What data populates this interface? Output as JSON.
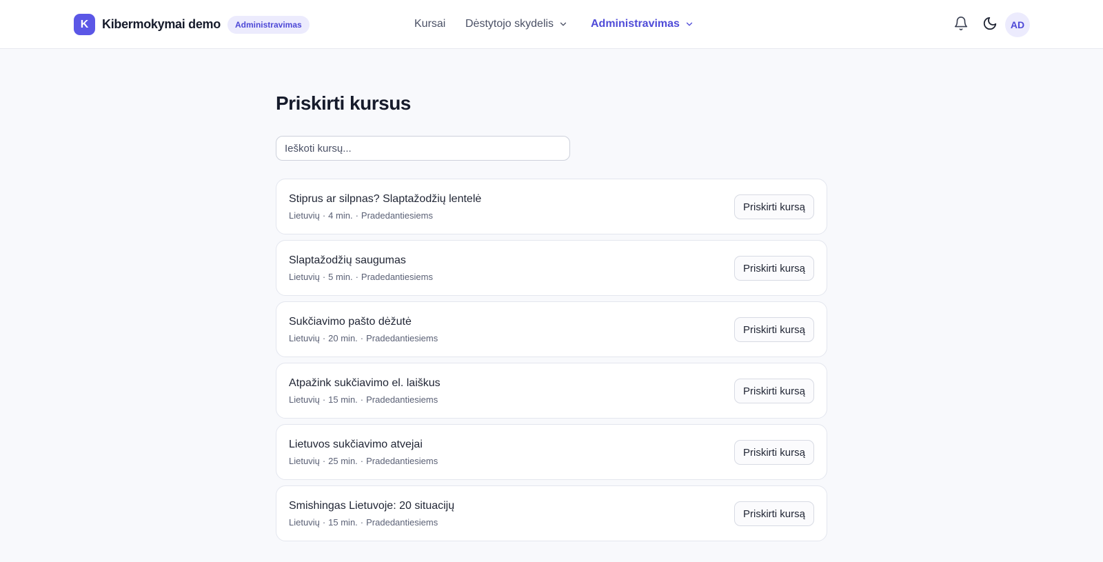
{
  "brand": {
    "logo_letter": "K",
    "name": "Kibermokymai demo",
    "badge": "Administravimas"
  },
  "nav": {
    "courses": "Kursai",
    "instructor_panel": "Dėstytojo skydelis",
    "administration": "Administravimas"
  },
  "header_icons": {
    "notifications": "bell-icon",
    "theme": "moon-icon"
  },
  "user": {
    "initials": "AD"
  },
  "page": {
    "title": "Priskirti kursus",
    "search_placeholder": "Ieškoti kursų..."
  },
  "courses": [
    {
      "title": "Stiprus ar silpnas? Slaptažodžių lentelė",
      "language": "Lietuvių",
      "duration": "4 min.",
      "level": "Pradedantiesiems",
      "action": "Priskirti kursą"
    },
    {
      "title": "Slaptažodžių saugumas",
      "language": "Lietuvių",
      "duration": "5 min.",
      "level": "Pradedantiesiems",
      "action": "Priskirti kursą"
    },
    {
      "title": "Sukčiavimo pašto dėžutė",
      "language": "Lietuvių",
      "duration": "20 min.",
      "level": "Pradedantiesiems",
      "action": "Priskirti kursą"
    },
    {
      "title": "Atpažink sukčiavimo el. laiškus",
      "language": "Lietuvių",
      "duration": "15 min.",
      "level": "Pradedantiesiems",
      "action": "Priskirti kursą"
    },
    {
      "title": "Lietuvos sukčiavimo atvejai",
      "language": "Lietuvių",
      "duration": "25 min.",
      "level": "Pradedantiesiems",
      "action": "Priskirti kursą"
    },
    {
      "title": "Smishingas Lietuvoje: 20 situacijų",
      "language": "Lietuvių",
      "duration": "15 min.",
      "level": "Pradedantiesiems",
      "action": "Priskirti kursą"
    }
  ],
  "meta_separator": "·",
  "colors": {
    "accent": "#5b57e6",
    "accent_text": "#4f4bd8",
    "badge_bg": "#ecebfd",
    "page_bg": "#f8f9fc"
  }
}
